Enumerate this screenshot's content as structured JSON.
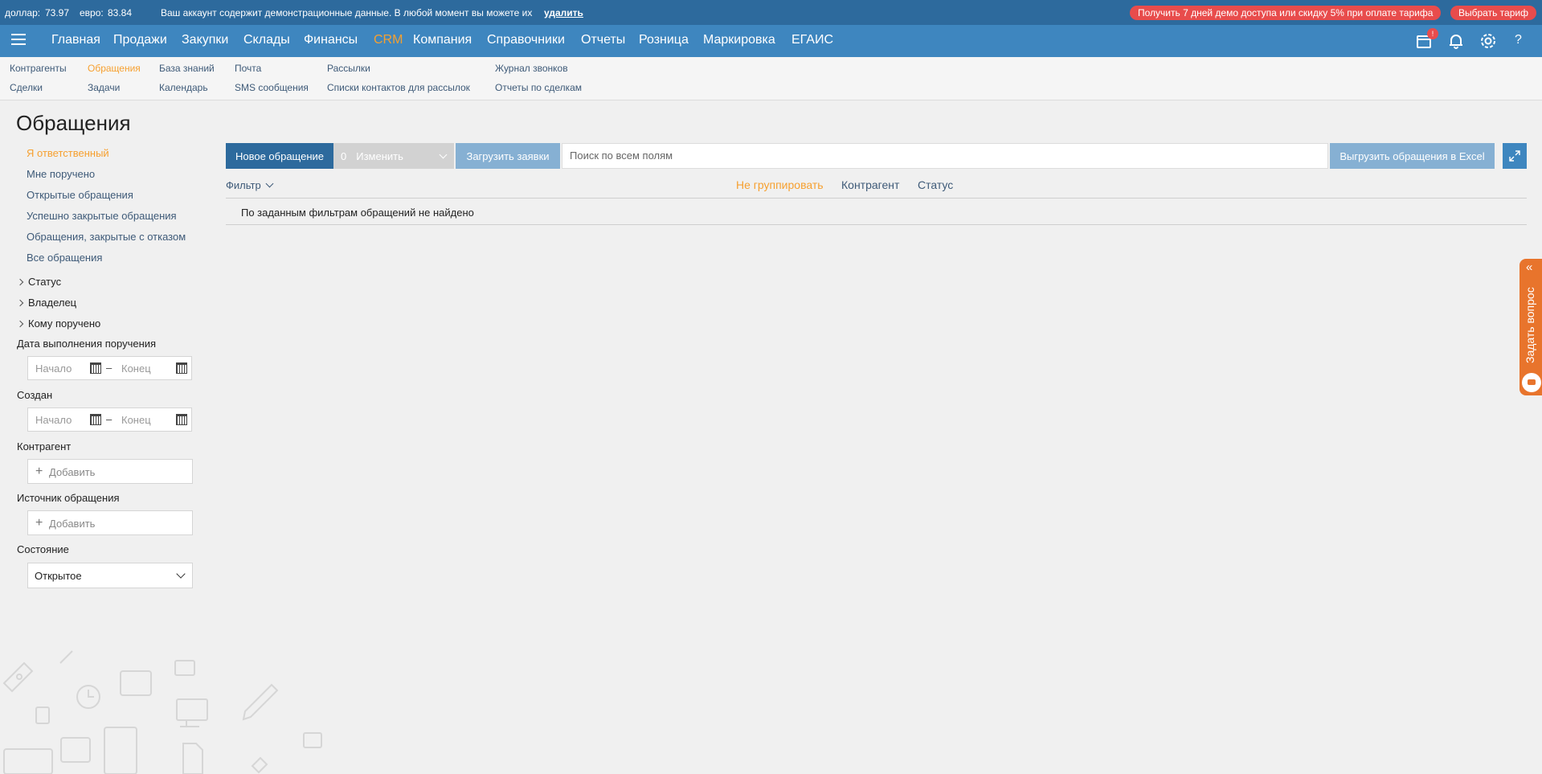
{
  "infobar": {
    "usd_label": "доллар:",
    "usd_value": "73.97",
    "eur_label": "евро:",
    "eur_value": "83.84",
    "demo_text": "Ваш аккаунт содержит демонстрационные данные. В любой момент вы можете их",
    "delete_link": "удалить",
    "promo_button": "Получить 7 дней демо доступа или скидку 5% при оплате тарифа",
    "tariff_button": "Выбрать тариф"
  },
  "nav": {
    "items": [
      "Главная",
      "Продажи",
      "Закупки",
      "Склады",
      "Финансы",
      "CRM",
      "Компания",
      "Справочники",
      "Отчеты",
      "Розница",
      "Маркировка",
      "ЕГАИС"
    ],
    "active": "CRM",
    "cart_badge": "!",
    "help": "?"
  },
  "subnav": {
    "items": [
      "Контрагенты",
      "Сделки",
      "Обращения",
      "Задачи",
      "База знаний",
      "Календарь",
      "Почта",
      "SMS сообщения",
      "Рассылки",
      "Списки контактов для рассылок",
      "Журнал звонков",
      "Отчеты по сделкам"
    ],
    "active": "Обращения"
  },
  "page": {
    "title": "Обращения"
  },
  "sidebar": {
    "quick_filters": [
      "Я ответственный",
      "Мне поручено",
      "Открытые обращения",
      "Успешно закрытые обращения",
      "Обращения, закрытые с отказом",
      "Все обращения"
    ],
    "groups": [
      "Статус",
      "Владелец",
      "Кому поручено"
    ],
    "due_date_label": "Дата выполнения поручения",
    "created_label": "Создан",
    "start_placeholder": "Начало",
    "end_placeholder": "Конец",
    "counterparty_label": "Контрагент",
    "source_label": "Источник обращения",
    "add_label": "Добавить",
    "state_label": "Состояние",
    "state_value": "Открытое"
  },
  "toolbar": {
    "new_button": "Новое обращение",
    "edit_count": "0",
    "edit_button": "Изменить",
    "upload_button": "Загрузить заявки",
    "search_placeholder": "Поиск по всем полям",
    "export_button": "Выгрузить обращения в Excel"
  },
  "list": {
    "filter_label": "Фильтр",
    "group_options": [
      "Не группировать",
      "Контрагент",
      "Статус"
    ],
    "group_active": "Не группировать",
    "empty_text": "По заданным фильтрам обращений не найдено"
  },
  "ask_tab": {
    "label": "Задать вопрос",
    "arrows": "«"
  },
  "colors": {
    "topbar": "#2d6a9d",
    "navbar": "#3e86bf",
    "accent": "#f6a030",
    "promo": "#e84c4c",
    "ask": "#e8742c"
  }
}
